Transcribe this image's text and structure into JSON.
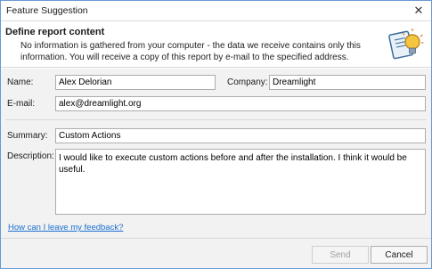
{
  "window": {
    "title": "Feature Suggestion",
    "close_icon": "close-icon"
  },
  "header": {
    "title": "Define report content",
    "description": "No information is gathered from your computer - the data we receive contains only this information. You will receive a copy of this report by e-mail to the specified address.",
    "icon": "report-lightbulb-icon"
  },
  "form": {
    "name_label": "Name:",
    "name_value": "Alex Delorian",
    "company_label": "Company:",
    "company_value": "Dreamlight",
    "email_label": "E-mail:",
    "email_value": "alex@dreamlight.org",
    "summary_label": "Summary:",
    "summary_value": "Custom Actions",
    "description_label": "Description:",
    "description_value": "I would like to execute custom actions before and after the installation. I think it would be useful.",
    "feedback_link": "How can I leave my feedback?"
  },
  "footer": {
    "send_label": "Send",
    "cancel_label": "Cancel"
  },
  "colors": {
    "link": "#1a6fd1",
    "border": "#adadad",
    "panel": "#f2f2f2"
  }
}
